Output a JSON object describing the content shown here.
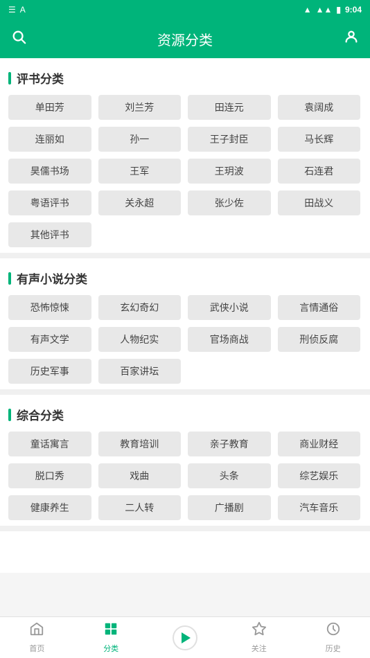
{
  "statusBar": {
    "leftIcon": "A",
    "time": "9:04"
  },
  "header": {
    "title": "资源分类",
    "searchIcon": "🔍",
    "userIcon": "👤"
  },
  "sections": [
    {
      "id": "pingshufenlei",
      "title": "评书分类",
      "tags": [
        "单田芳",
        "刘兰芳",
        "田连元",
        "袁阔成",
        "连丽如",
        "孙一",
        "王子封臣",
        "马长辉",
        "昊儒书场",
        "王军",
        "王玥波",
        "石连君",
        "粤语评书",
        "关永超",
        "张少佐",
        "田战义",
        "其他评书"
      ]
    },
    {
      "id": "youshengxiaoshuofenlei",
      "title": "有声小说分类",
      "tags": [
        "恐怖惊悚",
        "玄幻奇幻",
        "武侠小说",
        "言情通俗",
        "有声文学",
        "人物纪实",
        "官场商战",
        "刑侦反腐",
        "历史军事",
        "百家讲坛"
      ]
    },
    {
      "id": "zonghefenlei",
      "title": "综合分类",
      "tags": [
        "童话寓言",
        "教育培训",
        "亲子教育",
        "商业财经",
        "脱口秀",
        "戏曲",
        "头条",
        "综艺娱乐",
        "健康养生",
        "二人转",
        "广播剧",
        "汽车音乐"
      ]
    }
  ],
  "bottomNav": [
    {
      "id": "home",
      "label": "首页",
      "icon": "house",
      "active": false
    },
    {
      "id": "category",
      "label": "分类",
      "icon": "grid",
      "active": true
    },
    {
      "id": "play",
      "label": "",
      "icon": "play",
      "active": false
    },
    {
      "id": "follow",
      "label": "关注",
      "icon": "star",
      "active": false
    },
    {
      "id": "history",
      "label": "历史",
      "icon": "clock",
      "active": false
    }
  ]
}
